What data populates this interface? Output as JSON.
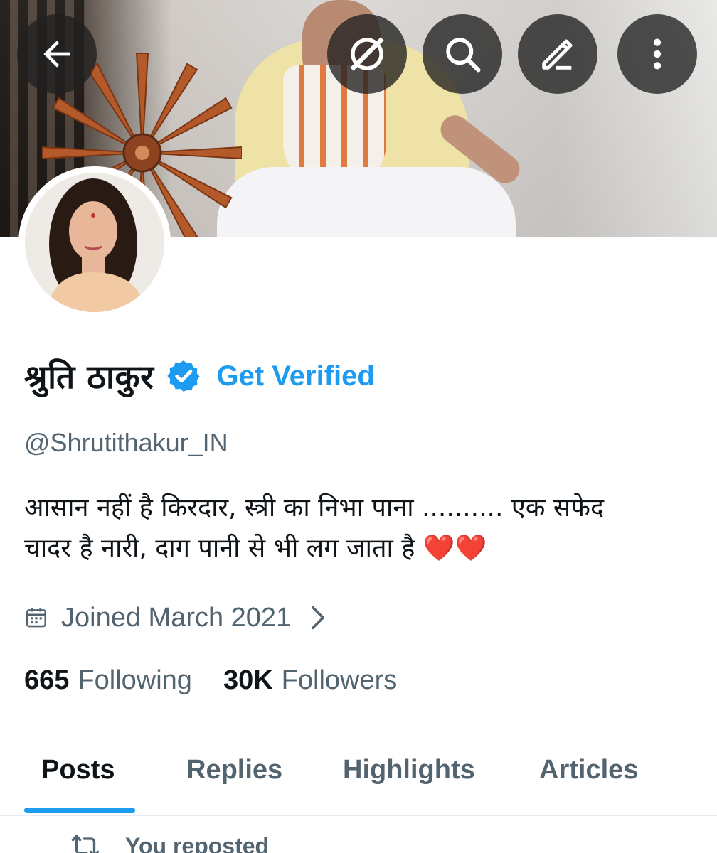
{
  "header": {
    "back_icon": "arrow-left-icon",
    "grok_icon": "grok-icon",
    "search_icon": "search-icon",
    "edit_icon": "edit-pen-icon",
    "more_icon": "more-vertical-icon"
  },
  "profile": {
    "display_name": "श्रुति ठाकुर",
    "verified_icon": "verified-badge-icon",
    "get_verified": "Get Verified",
    "handle": "@Shrutithakur_IN",
    "bio_line1": "आसान नहीं है किरदार, स्त्री का निभा पाना .......... एक सफेद",
    "bio_line2": "चादर है नारी, दाग पानी से भी लग जाता है",
    "bio_emoji": "❤️❤️",
    "joined": "Joined March 2021",
    "following_count": "665",
    "following_label": "Following",
    "followers_count": "30K",
    "followers_label": "Followers"
  },
  "tabs": [
    {
      "label": "Posts",
      "active": true
    },
    {
      "label": "Replies",
      "active": false
    },
    {
      "label": "Highlights",
      "active": false
    },
    {
      "label": "Articles",
      "active": false
    }
  ],
  "feed": {
    "repost_text": "You reposted"
  },
  "colors": {
    "accent": "#1d9bf0",
    "secondary_text": "#536471",
    "primary_text": "#0f1419",
    "heart": "#e0245e"
  }
}
